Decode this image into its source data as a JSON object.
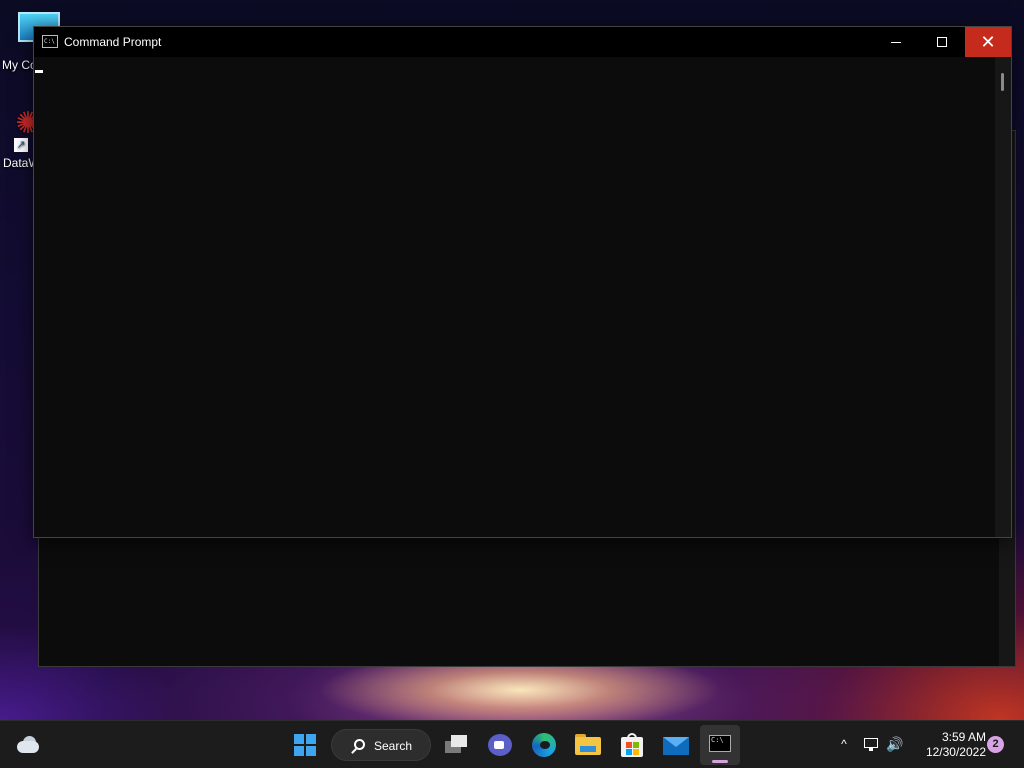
{
  "desktop": {
    "icons": [
      {
        "label": "My Co",
        "icon": "computer-icon"
      },
      {
        "label": "DataW",
        "icon": "datawarrior-icon"
      }
    ]
  },
  "window": {
    "title": "Command Prompt",
    "app_icon": "cmd-icon",
    "app_icon_glyph": "C:\\",
    "close_glyph": "✕",
    "controls": [
      "minimize",
      "maximize",
      "close"
    ]
  },
  "taskbar": {
    "search_label": "Search",
    "pinned": [
      "start-icon",
      "search-icon",
      "task-view-icon",
      "chat-icon",
      "edge-icon",
      "file-explorer-icon",
      "store-icon",
      "mail-icon",
      "command-prompt-icon"
    ],
    "cmd_glyph": "C:\\",
    "tray": {
      "chevron_glyph": "^",
      "volume_glyph": "🔊",
      "time": "3:59 AM",
      "date": "12/30/2022",
      "notification_count": "2"
    }
  },
  "colors": {
    "close_button": "#c42b1c",
    "console_bg": "#0c0c0c",
    "taskbar_bg": "#1c1c1c",
    "active_indicator": "#d7a1e0"
  }
}
